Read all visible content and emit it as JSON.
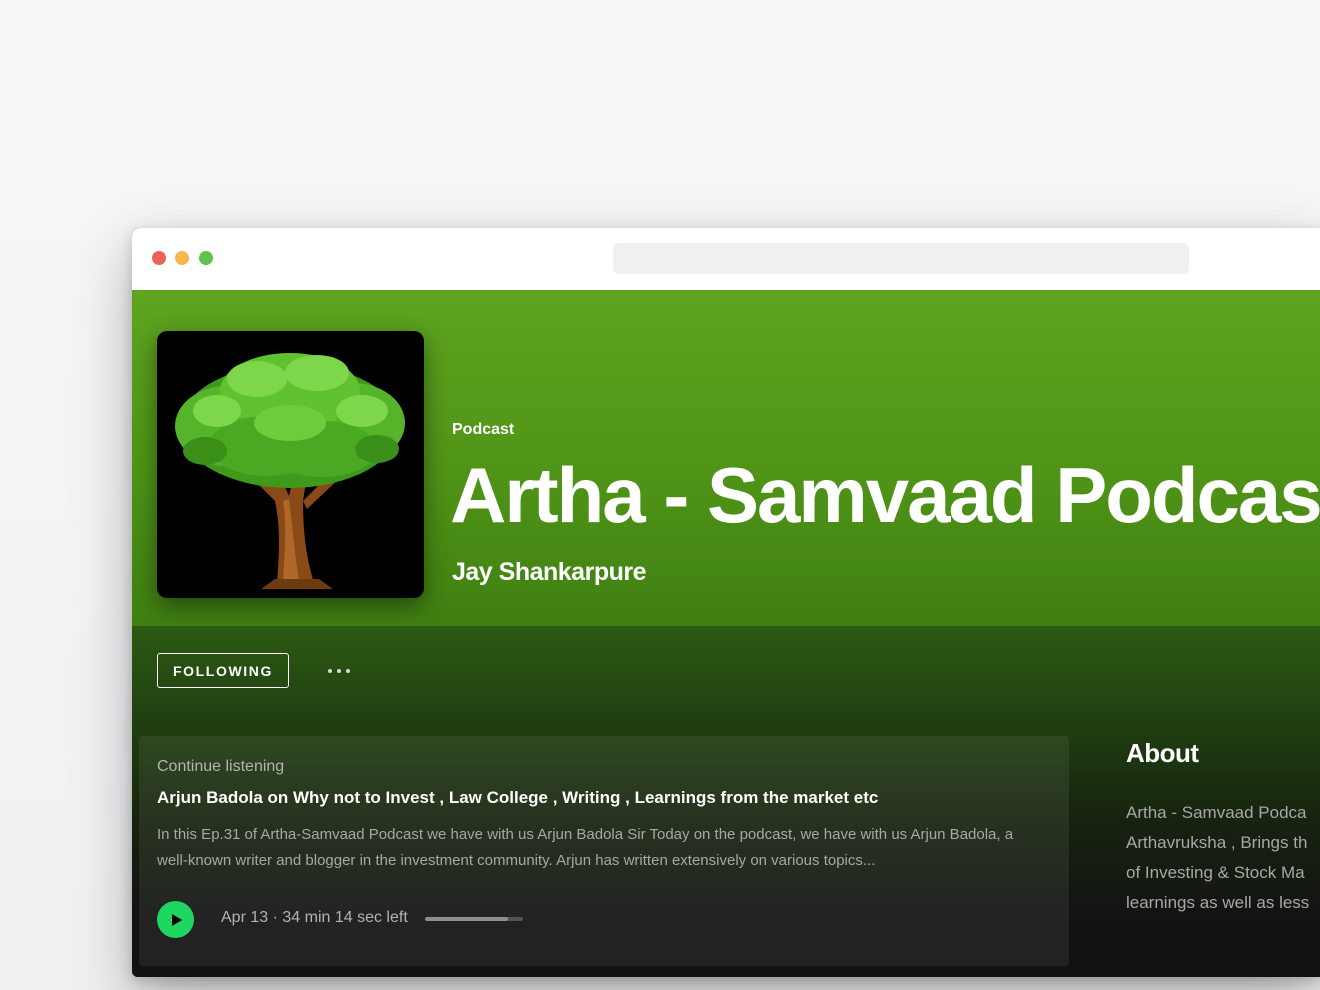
{
  "window": {
    "controls": [
      "close",
      "minimize",
      "maximize"
    ],
    "address_bar": ""
  },
  "hero": {
    "type_label": "Podcast",
    "title": "Artha - Samvaad Podcast",
    "author": "Jay Shankarpure",
    "cover_icon": "tree-icon",
    "gradient_top": "#5ea41f",
    "gradient_bottom": "#3f7f12"
  },
  "actions": {
    "follow_label": "FOLLOWING",
    "more_icon": "more-options-icon"
  },
  "continue_listening": {
    "label": "Continue listening",
    "episode_title": "Arjun Badola on Why not to Invest , Law College , Writing , Learnings from the market etc",
    "description": "In this Ep.31 of Artha-Samvaad Podcast we have with us Arjun Badola Sir Today on the podcast, we have with us Arjun Badola, a well-known writer and blogger in the investment community. Arjun has written extensively on various topics...",
    "date": "Apr 13",
    "separator": "·",
    "time_left": "34 min 14 sec left",
    "progress_fraction": 0.85,
    "play_color": "#1ed760"
  },
  "about": {
    "heading": "About",
    "text": "Artha - Samvaad Podca\nArthavruksha , Brings th\nof Investing & Stock Ma\nlearnings as well as less"
  }
}
